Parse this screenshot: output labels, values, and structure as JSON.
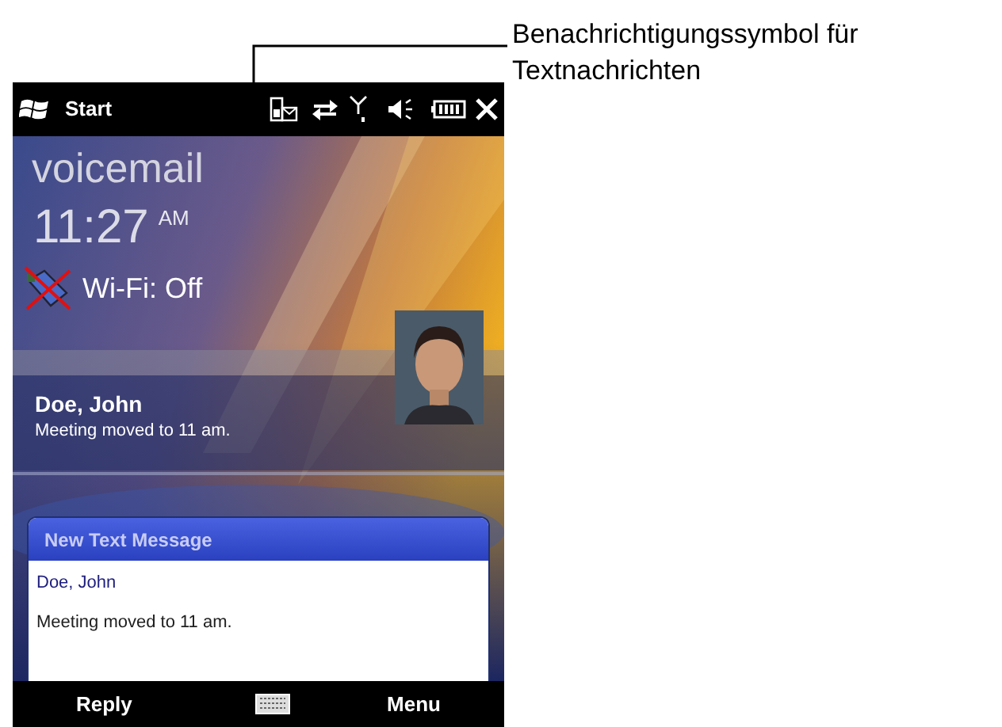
{
  "annotation": {
    "text": "Benachrichtigungssymbol für Textnachrichten"
  },
  "status_bar": {
    "start_label": "Start"
  },
  "today": {
    "title": "voicemail",
    "time": "11:27",
    "time_suffix": "AM",
    "wifi_status": "Wi-Fi: Off"
  },
  "message_item": {
    "sender": "Doe, John",
    "preview": "Meeting moved to 11 am."
  },
  "popup": {
    "title": "New Text Message",
    "sender": "Doe, John",
    "body": "Meeting moved to 11 am."
  },
  "softkeys": [
    "Reply",
    "Menu"
  ]
}
